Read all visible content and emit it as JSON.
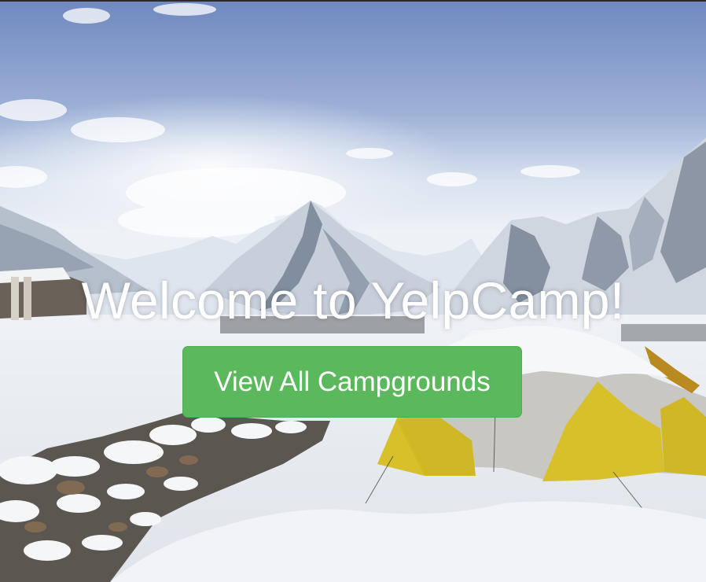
{
  "landing": {
    "title": "Welcome to YelpCamp!",
    "cta_label": "View All Campgrounds"
  },
  "colors": {
    "button_bg": "#5cb85c",
    "title_text": "#ffffff",
    "sky": "#7f97c6",
    "tent": "#d8c02a"
  }
}
